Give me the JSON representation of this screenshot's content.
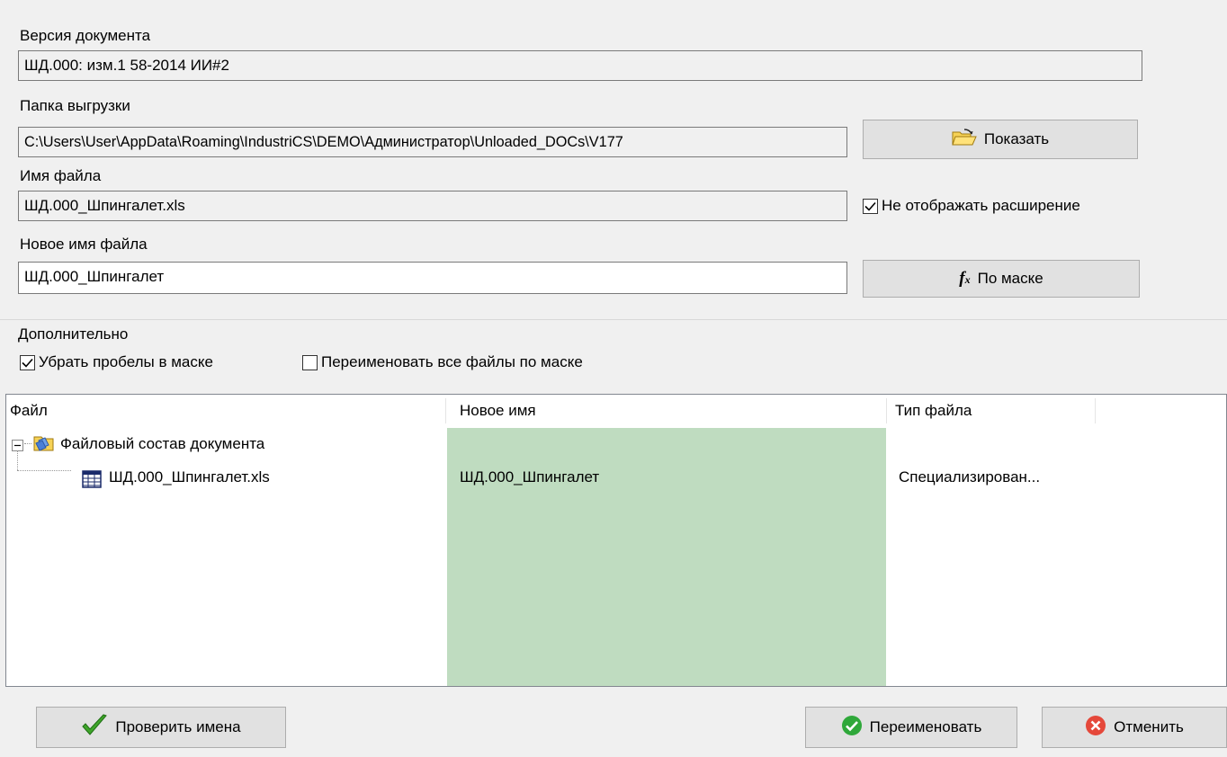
{
  "form": {
    "doc_version_label": "Версия документа",
    "doc_version_value": "ШД.000: изм.1 58-2014 ИИ#2",
    "export_folder_label": "Папка выгрузки",
    "export_folder_value": "C:\\Users\\User\\AppData\\Roaming\\IndustriCS\\DEMO\\Администратор\\Unloaded_DOCs\\V177",
    "show_button": "Показать",
    "file_name_label": "Имя файла",
    "file_name_value": "ШД.000_Шпингалет.xls",
    "hide_extension_label": "Не отображать расширение",
    "hide_extension_checked": true,
    "new_file_name_label": "Новое имя файла",
    "new_file_name_value": "ШД.000_Шпингалет",
    "by_mask_button": "По маске"
  },
  "additional": {
    "group_label": "Дополнительно",
    "remove_spaces_label": "Убрать пробелы в маске",
    "remove_spaces_checked": true,
    "rename_all_label": "Переименовать все файлы по маске",
    "rename_all_checked": false
  },
  "table": {
    "columns": [
      "Файл",
      "Новое имя",
      "Тип файла"
    ],
    "root_label": "Файловый состав документа",
    "rows": [
      {
        "file": "ШД.000_Шпингалет.xls",
        "new_name": "ШД.000_Шпингалет",
        "type": "Специализирован..."
      }
    ],
    "highlight_color": "#bfdcc0"
  },
  "footer": {
    "check_names_button": "Проверить имена",
    "rename_button": "Переименовать",
    "cancel_button": "Отменить"
  }
}
